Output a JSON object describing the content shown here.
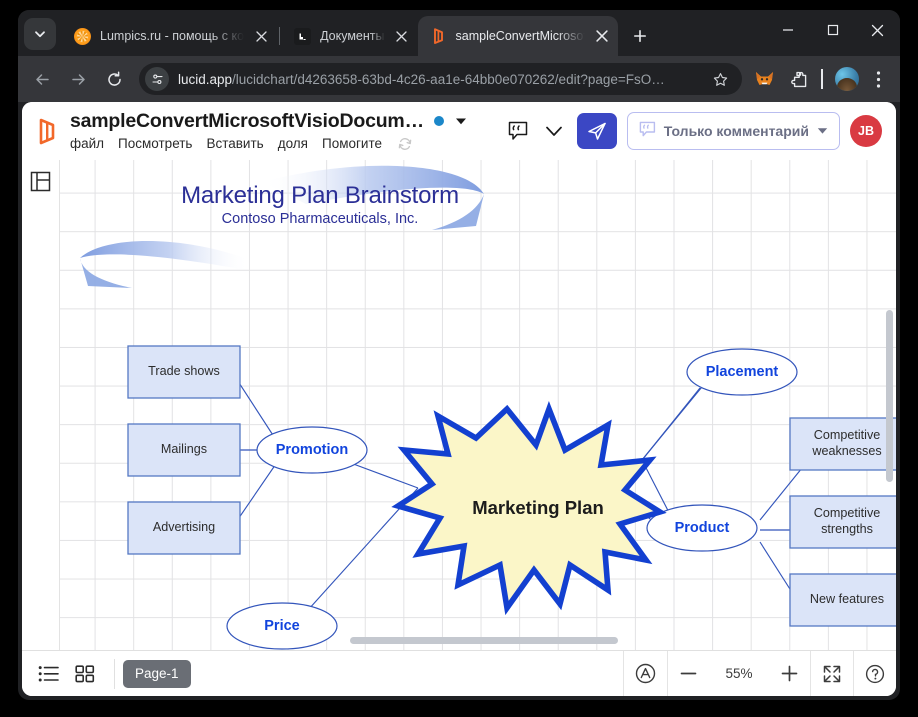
{
  "browser": {
    "tab_list_button": "tab-search",
    "tabs": [
      {
        "title": "Lumpics.ru - помощь с ко",
        "favicon": "orange-citrus-icon",
        "active": false
      },
      {
        "title": "Документы",
        "favicon": "documents-icon",
        "active": false
      },
      {
        "title": "sampleConvertMicrosoftV",
        "favicon": "lucid-icon",
        "active": true
      }
    ],
    "new_tab_label": "+",
    "window_controls": {
      "minimize": "–",
      "maximize": "□",
      "close": "✕"
    },
    "omnibox": {
      "domain": "lucid.app",
      "path": "/lucidchart/d4263658-63bd-4c26-aa1e-64bb0e070262/edit?page=FsO…",
      "site_info_icon": "page-settings-icon",
      "bookmark_icon": "star-icon"
    },
    "extensions": [
      {
        "name": "metamask-fox-icon"
      },
      {
        "name": "extensions-puzzle-icon"
      }
    ],
    "profile_icon": "profile-avatar",
    "menu_icon": "kebab-menu-icon"
  },
  "app": {
    "logo": "lucid-logo-icon",
    "document_title": "sampleConvertMicrosoftVisioDocum…",
    "status_dot_color": "#1b87c9",
    "title_caret": "chevron-down-icon",
    "menu": [
      "файл",
      "Посмотреть",
      "Вставить",
      "доля",
      "Помогите"
    ],
    "sync_icon": "sync-refresh-icon",
    "right": {
      "comment_icon": "comment-quote-icon",
      "chevron_icon": "chevron-down-icon",
      "share_icon": "paper-plane-icon",
      "permission_label": "Только комментарий",
      "permission_icon": "comment-quote-icon",
      "permission_caret": "caret-down-icon",
      "avatar_initials": "JB",
      "avatar_color": "#d93a42"
    },
    "left_rail": {
      "panel_icon": "layout-panel-icon"
    },
    "bottom": {
      "list_icon": "list-view-icon",
      "grid_icon": "grid-view-icon",
      "page_tab": "Page-1",
      "annotate_icon": "annotate-circle-a-icon",
      "zoom_out": "−",
      "zoom_level": "55%",
      "zoom_in": "+",
      "fullscreen_icon": "fit-screen-icon",
      "help_icon": "help-question-icon"
    }
  },
  "diagram": {
    "title": "Marketing Plan Brainstorm",
    "subtitle": "Contoso Pharmaceuticals, Inc.",
    "center": {
      "label": "Marketing Plan",
      "fill": "#fbf6c8",
      "stroke": "#1340d0"
    },
    "ellipses": [
      {
        "label": "Promotion"
      },
      {
        "label": "Placement"
      },
      {
        "label": "Product"
      },
      {
        "label": "Price"
      }
    ],
    "boxes": [
      {
        "label": "Trade shows"
      },
      {
        "label": "Mailings"
      },
      {
        "label": "Advertising"
      },
      {
        "label": "Competitive weaknesses"
      },
      {
        "label": "Competitive strengths"
      },
      {
        "label": "New features"
      }
    ],
    "colors": {
      "box_fill": "#dbe4f8",
      "box_stroke": "#5578c4",
      "label_blue": "#1144dd",
      "title_blue": "#2b2f96"
    }
  }
}
